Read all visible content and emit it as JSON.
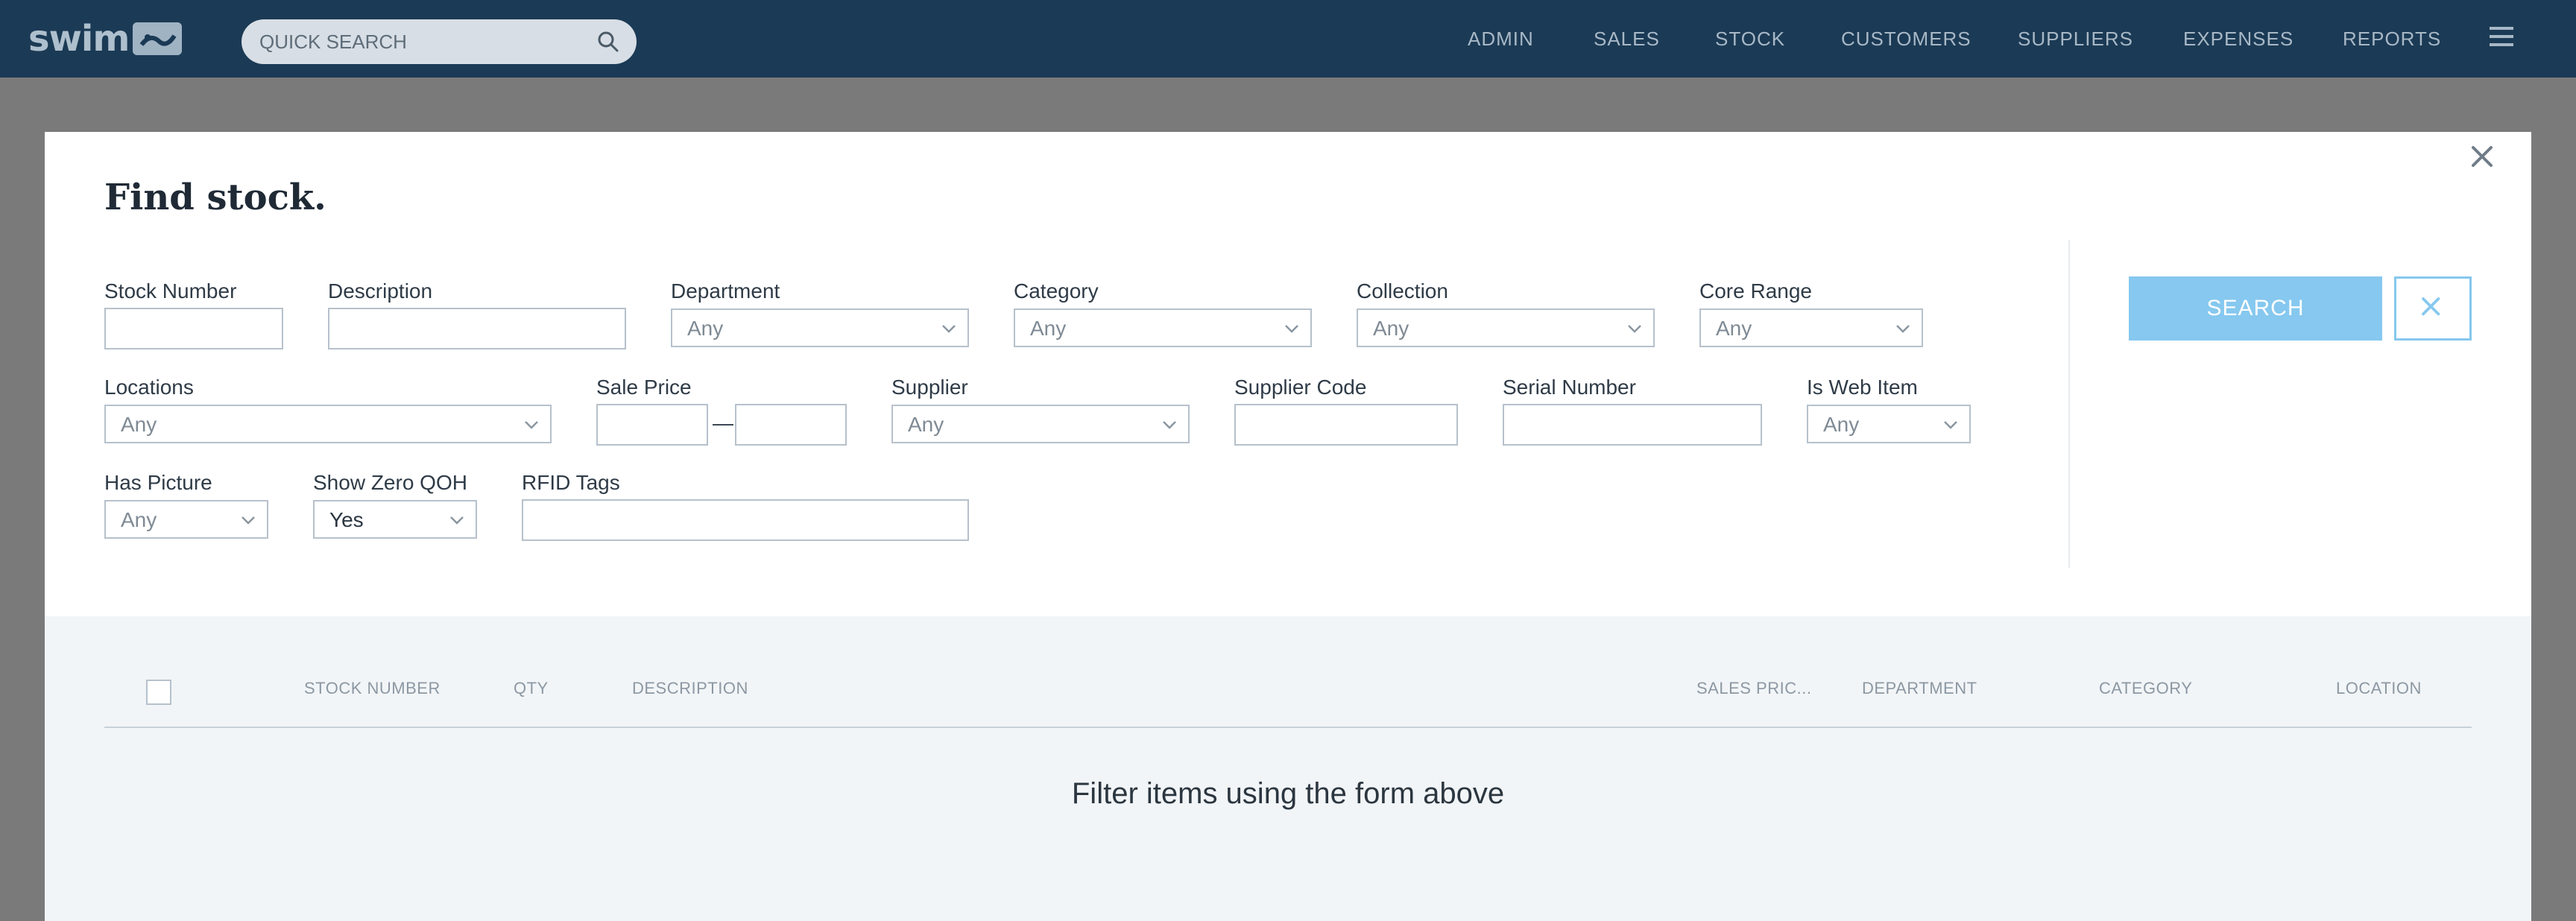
{
  "app": {
    "logo_text": "swim"
  },
  "topbar": {
    "search_placeholder": "QUICK SEARCH",
    "nav": [
      "ADMIN",
      "SALES",
      "STOCK",
      "CUSTOMERS",
      "SUPPLIERS",
      "EXPENSES",
      "REPORTS"
    ]
  },
  "modal": {
    "title": "Find stock.",
    "fields": {
      "stock_number": "Stock Number",
      "description": "Description",
      "department": {
        "label": "Department",
        "value": "Any"
      },
      "category": {
        "label": "Category",
        "value": "Any"
      },
      "collection": {
        "label": "Collection",
        "value": "Any"
      },
      "core_range": {
        "label": "Core Range",
        "value": "Any"
      },
      "locations": {
        "label": "Locations",
        "value": "Any"
      },
      "sale_price": {
        "label": "Sale Price",
        "separator": "—"
      },
      "supplier": {
        "label": "Supplier",
        "value": "Any"
      },
      "supplier_code": "Supplier Code",
      "serial_number": "Serial Number",
      "is_web_item": {
        "label": "Is Web Item",
        "value": "Any"
      },
      "has_picture": {
        "label": "Has Picture",
        "value": "Any"
      },
      "show_zero_qoh": {
        "label": "Show Zero QOH",
        "value": "Yes"
      },
      "rfid_tags": "RFID Tags"
    },
    "search_label": "SEARCH"
  },
  "results": {
    "columns": [
      "STOCK NUMBER",
      "QTY",
      "DESCRIPTION",
      "SALES PRIC...",
      "DEPARTMENT",
      "CATEGORY",
      "LOCATION"
    ],
    "empty_message": "Filter items using the form above"
  },
  "colors": {
    "topbar": "#1b3a55",
    "accent": "#86c8ef",
    "overlay": "#7a7a7a",
    "results_bg": "#f2f5f7"
  }
}
